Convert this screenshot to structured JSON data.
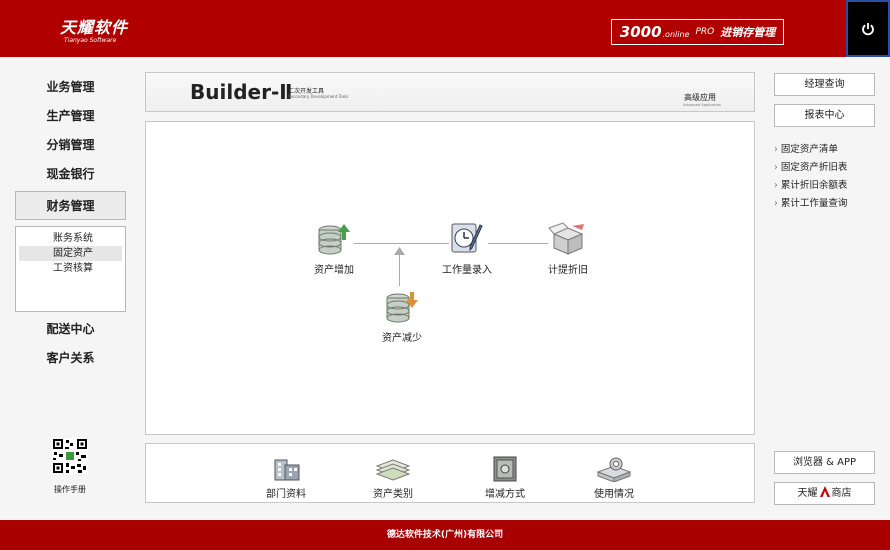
{
  "header": {
    "logo_main": "天耀软件",
    "logo_sub": "Tianyao Software",
    "product_num": "3000",
    "product_online": ".online",
    "product_pro": "PRO",
    "product_title": "进销存管理"
  },
  "leftnav": {
    "items_top": [
      "业务管理",
      "生产管理",
      "分销管理",
      "现金银行",
      "财务管理"
    ],
    "submenu": [
      "账务系统",
      "固定资产",
      "工资核算"
    ],
    "items_bottom": [
      "配送中心",
      "客户关系"
    ],
    "manual_label": "操作手册"
  },
  "banner": {
    "title": "Builder-Ⅱ",
    "subtitle_cn": "二次开发工具",
    "subtitle_en": "Secondary Development Tools",
    "advanced": "高级应用",
    "advanced_en": "Advanced Application"
  },
  "flow": {
    "asset_add": "资产增加",
    "asset_reduce": "资产减少",
    "workload": "工作量录入",
    "depreciation": "计提折旧"
  },
  "bottom": [
    "部门资料",
    "资产类别",
    "增减方式",
    "使用情况"
  ],
  "right": {
    "manager_query": "经理查询",
    "report_center": "报表中心",
    "links": [
      "固定资产清单",
      "固定资产折旧表",
      "累计折旧余额表",
      "累计工作量查询"
    ],
    "browser_app": "浏览器 & APP",
    "shop_prefix": "天耀",
    "shop_suffix": "商店"
  },
  "footer": "德达软件技术(广州)有限公司"
}
